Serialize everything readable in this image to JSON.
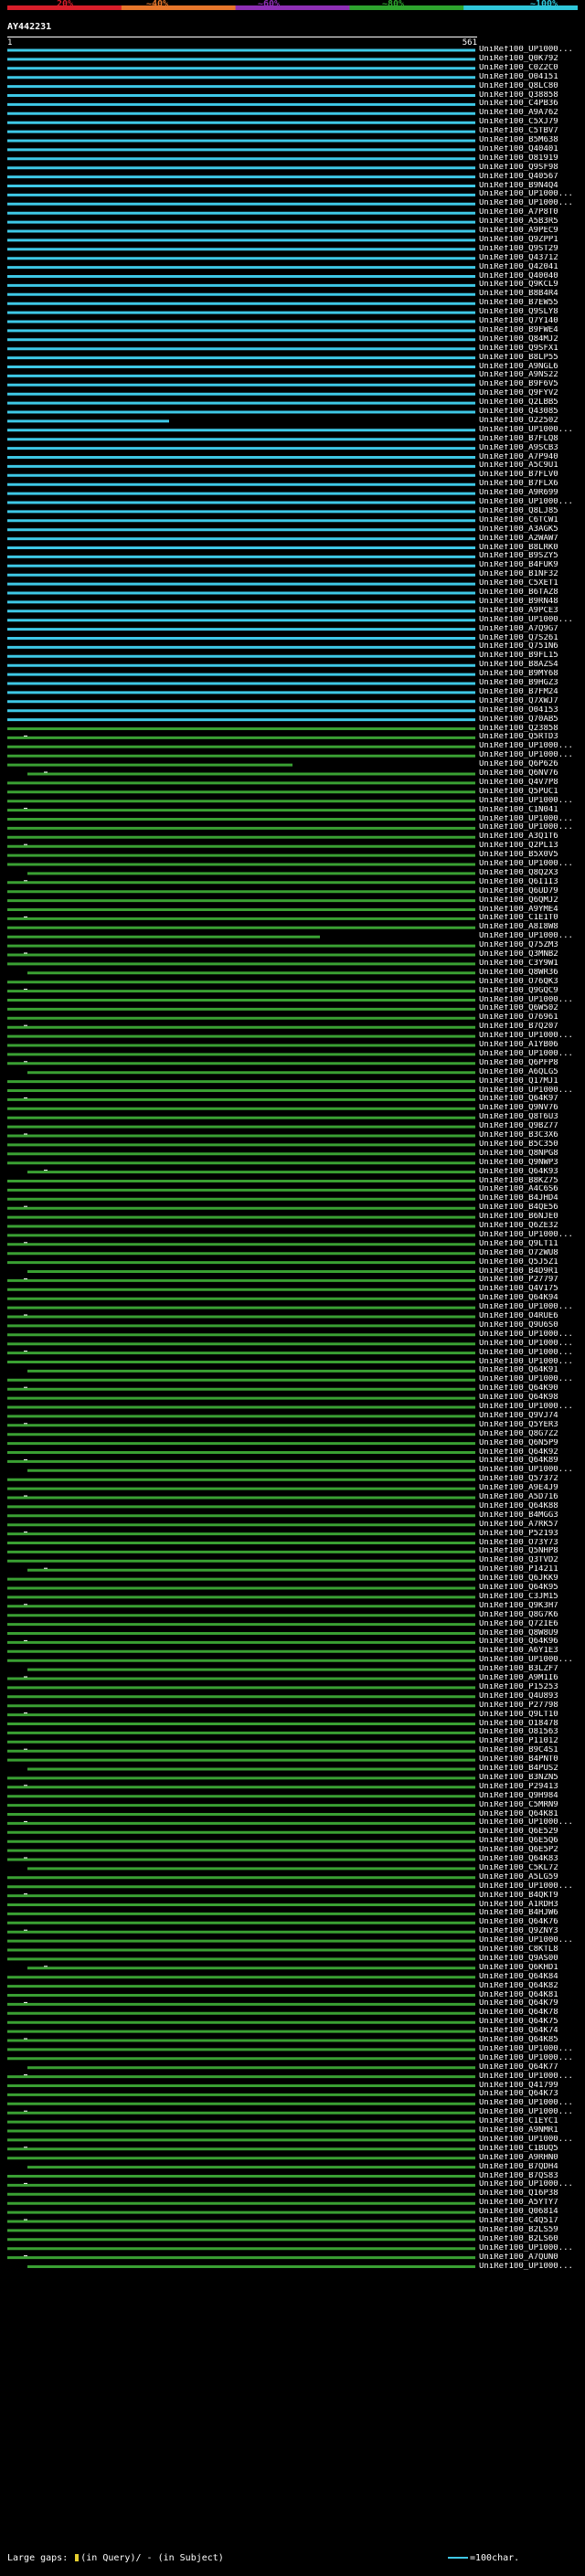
{
  "scale": {
    "labels": [
      "20%",
      "~40%",
      "~60%",
      "~80%",
      "~100%"
    ],
    "colors": [
      "#d81e2a",
      "#e6762b",
      "#8e2fb5",
      "#2ea42e",
      "#2fc7da"
    ]
  },
  "query": {
    "title": "AY442231",
    "ruler_start": "1",
    "ruler_end": "561"
  },
  "colors": {
    "high": "#3ec8e6",
    "mid": "#3aa033",
    "insert": "#ffffff",
    "gap": "#e6cf2f"
  },
  "hits": [
    "UniRef100_UP1000...",
    "UniRef100_Q0K792",
    "UniRef100_C0Z2C0",
    "UniRef100_O04151",
    "UniRef100_Q8LC80",
    "UniRef100_Q38858",
    "UniRef100_C4PB36",
    "UniRef100_A9A762",
    "UniRef100_C5XJ79",
    "UniRef100_C5TBV7",
    "UniRef100_B5M638",
    "UniRef100_Q40401",
    "UniRef100_O81919",
    "UniRef100_Q9SF98",
    "UniRef100_Q40567",
    "UniRef100_B9N4Q4",
    "UniRef100_UP1000...",
    "UniRef100_UP1000...",
    "UniRef100_A7P8T0",
    "UniRef100_A5B3R5",
    "UniRef100_A9PEC9",
    "UniRef100_Q9ZPP1",
    "UniRef100_Q9ST29",
    "UniRef100_Q43712",
    "UniRef100_Q42041",
    "UniRef100_Q40040",
    "UniRef100_Q9KCL9",
    "UniRef100_B8B4R4",
    "UniRef100_B7EW55",
    "UniRef100_Q9SLY8",
    "UniRef100_Q7Y140",
    "UniRef100_B9FWE4",
    "UniRef100_Q84MJ2",
    "UniRef100_Q9SFX1",
    "UniRef100_B8LP55",
    "UniRef100_A9NGL6",
    "UniRef100_A9NS22",
    "UniRef100_B9F6V5",
    "UniRef100_Q9FYV2",
    "UniRef100_Q2LBB5",
    "UniRef100_Q43085",
    "UniRef100_O22502",
    "UniRef100_UP1000...",
    "UniRef100_B7FLQ8",
    "UniRef100_A9SCB3",
    "UniRef100_A7P940",
    "UniRef100_A5C9U1",
    "UniRef100_B7FLV0",
    "UniRef100_B7FLX6",
    "UniRef100_A9R699",
    "UniRef100_UP1000...",
    "UniRef100_Q8LJ85",
    "UniRef100_C6TCW1",
    "UniRef100_A3AGK5",
    "UniRef100_A2WAW7",
    "UniRef100_B8LRK0",
    "UniRef100_B9SZY5",
    "UniRef100_B4FUK9",
    "UniRef100_B1NF32",
    "UniRef100_C5XET1",
    "UniRef100_B6TAZ8",
    "UniRef100_B9RN48",
    "UniRef100_A9PCE3",
    "UniRef100_UP1000...",
    "UniRef100_A7Q9G7",
    "UniRef100_Q7S261",
    "UniRef100_Q751N6",
    "UniRef100_B9FL15",
    "UniRef100_B8AZS4",
    "UniRef100_B9MY68",
    "UniRef100_B9HGZ3",
    "UniRef100_B7FM24",
    "UniRef100_Q7XWJ7",
    "UniRef100_O04153",
    "UniRef100_Q70AB5",
    "UniRef100_Q23858",
    "UniRef100_Q5RTD3",
    "UniRef100_UP1000...",
    "UniRef100_UP1000...",
    "UniRef100_Q6P626",
    "UniRef100_Q6NV76",
    "UniRef100_Q4V7P8",
    "UniRef100_Q5PUC1",
    "UniRef100_UP1000...",
    "UniRef100_C1N041",
    "UniRef100_UP1000...",
    "UniRef100_UP1000...",
    "UniRef100_A3Q1T6",
    "UniRef100_Q2PL13",
    "UniRef100_B5X0V5",
    "UniRef100_UP1000...",
    "UniRef100_Q8Q2X3",
    "UniRef100_Q6I1I3",
    "UniRef100_Q6UD79",
    "UniRef100_Q6QMJ2",
    "UniRef100_A9YME4",
    "UniRef100_C1E1T0",
    "UniRef100_A8I8W8",
    "UniRef100_UP1000...",
    "UniRef100_Q75ZM3",
    "UniRef100_Q3MNB2",
    "UniRef100_C3Y9W1",
    "UniRef100_Q8WR36",
    "UniRef100_O76QK3",
    "UniRef100_Q9GQC9",
    "UniRef100_UP1000...",
    "UniRef100_Q6W502",
    "UniRef100_O76961",
    "UniRef100_B7Q207",
    "UniRef100_UP1000...",
    "UniRef100_A1YB06",
    "UniRef100_UP1000...",
    "UniRef100_Q6PFP8",
    "UniRef100_A6QLG5",
    "UniRef100_Q17MJ1",
    "UniRef100_UP1000...",
    "UniRef100_Q64K97",
    "UniRef100_Q9NV76",
    "UniRef100_Q8T6U3",
    "UniRef100_Q9BZ77",
    "UniRef100_B3C3X6",
    "UniRef100_B5C350",
    "UniRef100_Q8NPG8",
    "UniRef100_Q9NWP3",
    "UniRef100_Q64K93",
    "UniRef100_B8KZ75",
    "UniRef100_A4C6S6",
    "UniRef100_B4JHD4",
    "UniRef100_B4QE56",
    "UniRef100_B6NJE0",
    "UniRef100_Q6ZE32",
    "UniRef100_UP1000...",
    "UniRef100_Q9LT11",
    "UniRef100_O72WU8",
    "UniRef100_Q5J5Z1",
    "UniRef100_B4D9R1",
    "UniRef100_P27797",
    "UniRef100_Q4V175",
    "UniRef100_Q64K94",
    "UniRef100_UP1000...",
    "UniRef100_O4RUE6",
    "UniRef100_Q9U6S0",
    "UniRef100_UP1000...",
    "UniRef100_UP1000...",
    "UniRef100_UP1000...",
    "UniRef100_UP1000...",
    "UniRef100_Q64K91",
    "UniRef100_UP1000...",
    "UniRef100_Q64K90",
    "UniRef100_Q64K98",
    "UniRef100_UP1000...",
    "UniRef100_Q9VJ74",
    "UniRef100_Q5YER3",
    "UniRef100_Q8G7Z2",
    "UniRef100_Q6N5P9",
    "UniRef100_Q64K92",
    "UniRef100_Q64K89",
    "UniRef100_UP1000...",
    "UniRef100_Q57372",
    "UniRef100_A9E4J9",
    "UniRef100_A5D716",
    "UniRef100_Q64K88",
    "UniRef100_B4MGG3",
    "UniRef100_A7RK57",
    "UniRef100_P52193",
    "UniRef100_O73Y73",
    "UniRef100_Q5NHP8",
    "UniRef100_Q3TVD2",
    "UniRef100_P14211",
    "UniRef100_Q6JKK9",
    "UniRef100_Q64K95",
    "UniRef100_C3JM15",
    "UniRef100_Q9K3H7",
    "UniRef100_Q8G7K6",
    "UniRef100_Q72IE6",
    "UniRef100_Q8W8U9",
    "UniRef100_Q64K96",
    "UniRef100_A6Y1E3",
    "UniRef100_UP1000...",
    "UniRef100_B3LZF7",
    "UniRef100_A9M1I6",
    "UniRef100_P15253",
    "UniRef100_Q4U893",
    "UniRef100_P27798",
    "UniRef100_Q9LT10",
    "UniRef100_O18478",
    "UniRef100_O81563",
    "UniRef100_P11012",
    "UniRef100_B9C4S1",
    "UniRef100_B4PNT0",
    "UniRef100_B4PUS2",
    "UniRef100_B3NZN5",
    "UniRef100_P29413",
    "UniRef100_Q9H984",
    "UniRef100_C5MRN9",
    "UniRef100_Q64K81",
    "UniRef100_UP1000...",
    "UniRef100_Q6E529",
    "UniRef100_Q6E5Q6",
    "UniRef100_Q6E5P2",
    "UniRef100_Q64K83",
    "UniRef100_C5KL72",
    "UniRef100_A5LG59",
    "UniRef100_UP1000...",
    "UniRef100_B4QKT9",
    "UniRef100_A1RDH3",
    "UniRef100_B4HJW6",
    "UniRef100_Q64K76",
    "UniRef100_Q9ZNY3",
    "UniRef100_UP1000...",
    "UniRef100_C8KTL8",
    "UniRef100_Q9AS00",
    "UniRef100_Q6KHD1",
    "UniRef100_Q64K84",
    "UniRef100_Q64K82",
    "UniRef100_Q64K81",
    "UniRef100_Q64K79",
    "UniRef100_Q64K78",
    "UniRef100_Q64K75",
    "UniRef100_Q64K74",
    "UniRef100_Q64K85",
    "UniRef100_UP1000...",
    "UniRef100_UP1000...",
    "UniRef100_Q64K77",
    "UniRef100_UP1000...",
    "UniRef100_Q41799",
    "UniRef100_Q64K73",
    "UniRef100_UP1000...",
    "UniRef100_UP1000...",
    "UniRef100_C1EYC1",
    "UniRef100_A9NMR1",
    "UniRef100_UP1000...",
    "UniRef100_C1BUQ5",
    "UniRef100_A9RHN0",
    "UniRef100_B7QDH4",
    "UniRef100_B7QS83",
    "UniRef100_UP1000...",
    "UniRef100_Q16P38",
    "UniRef100_A5YTY7",
    "UniRef100_Q06814",
    "UniRef100_C4Q517",
    "UniRef100_B2LS59",
    "UniRef100_B2LS60",
    "UniRef100_UP1000...",
    "UniRef100_A7QUN0",
    "UniRef100_UP1000..."
  ],
  "footer": {
    "large_gaps_label": "Large gaps:",
    "in_query": "(in Query)/",
    "in_subject": "- (in Subject)"
  },
  "legend": {
    "label": "=100char."
  }
}
